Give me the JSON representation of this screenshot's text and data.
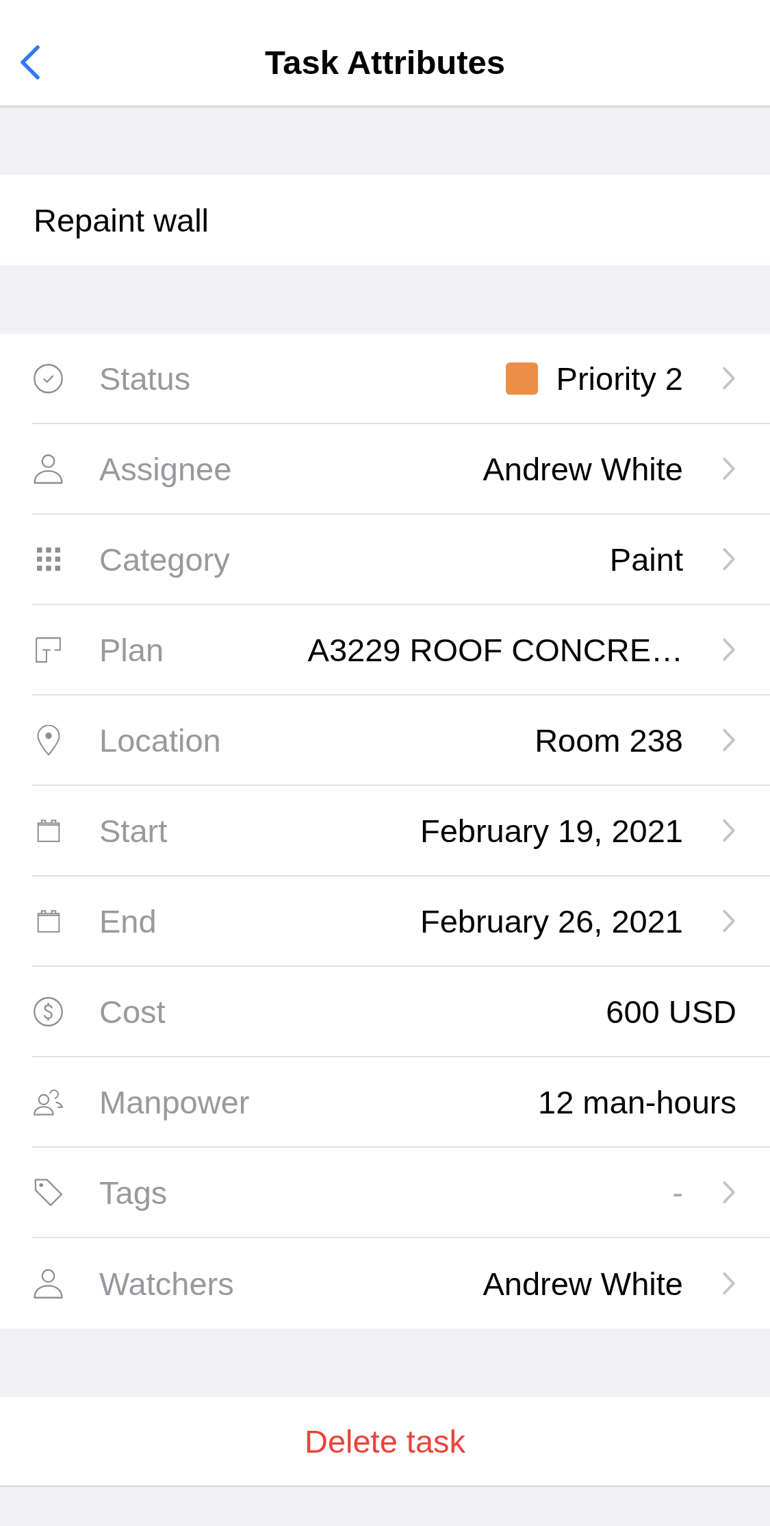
{
  "nav": {
    "title": "Task Attributes"
  },
  "task": {
    "name": "Repaint wall"
  },
  "attributes": [
    {
      "kind": "status",
      "label": "Status",
      "value": "Priority 2",
      "color": "#eb8f48",
      "disclosure": true
    },
    {
      "kind": "person",
      "label": "Assignee",
      "value": "Andrew White",
      "disclosure": true
    },
    {
      "kind": "category",
      "label": "Category",
      "value": "Paint",
      "disclosure": true
    },
    {
      "kind": "plan",
      "label": "Plan",
      "value": "A3229 ROOF CONCRE…",
      "disclosure": true
    },
    {
      "kind": "location",
      "label": "Location",
      "value": "Room 238",
      "disclosure": true
    },
    {
      "kind": "date",
      "label": "Start",
      "value": "February 19, 2021",
      "disclosure": true
    },
    {
      "kind": "date",
      "label": "End",
      "value": "February 26, 2021",
      "disclosure": true
    },
    {
      "kind": "cost",
      "label": "Cost",
      "value": "600 USD",
      "disclosure": false
    },
    {
      "kind": "team",
      "label": "Manpower",
      "value": "12 man-hours",
      "disclosure": false
    },
    {
      "kind": "tags",
      "label": "Tags",
      "placeholder": "-",
      "disclosure": true
    },
    {
      "kind": "person",
      "label": "Watchers",
      "value": "Andrew White",
      "disclosure": true
    }
  ],
  "delete_button": {
    "label": "Delete task"
  }
}
